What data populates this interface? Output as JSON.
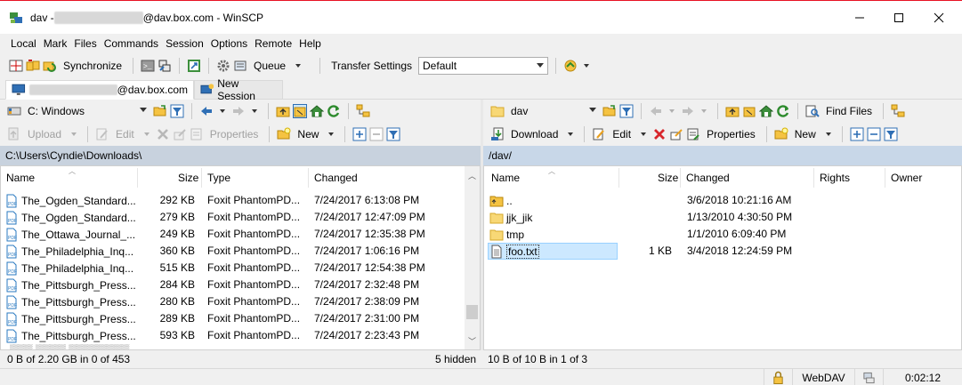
{
  "window": {
    "title_prefix": "dav - ",
    "title_suffix": "@dav.box.com - WinSCP"
  },
  "menu": [
    "Local",
    "Mark",
    "Files",
    "Commands",
    "Session",
    "Options",
    "Remote",
    "Help"
  ],
  "toolbar": {
    "synchronize": "Synchronize",
    "queue": "Queue",
    "transfer_settings_label": "Transfer Settings",
    "transfer_settings_value": "Default"
  },
  "tabs": {
    "session_suffix": "@dav.box.com",
    "new_session": "New Session"
  },
  "left": {
    "drive": "C: Windows",
    "upload": "Upload",
    "edit": "Edit",
    "properties": "Properties",
    "new": "New",
    "path": "C:\\Users\\Cyndie\\Downloads\\",
    "columns": {
      "name": "Name",
      "size": "Size",
      "type": "Type",
      "changed": "Changed"
    },
    "files": [
      {
        "name": "The_Ogden_Standard...",
        "size": "292 KB",
        "type": "Foxit PhantomPD...",
        "changed": "7/24/2017  6:13:08 PM"
      },
      {
        "name": "The_Ogden_Standard...",
        "size": "279 KB",
        "type": "Foxit PhantomPD...",
        "changed": "7/24/2017  12:47:09 PM"
      },
      {
        "name": "The_Ottawa_Journal_...",
        "size": "249 KB",
        "type": "Foxit PhantomPD...",
        "changed": "7/24/2017  12:35:38 PM"
      },
      {
        "name": "The_Philadelphia_Inq...",
        "size": "360 KB",
        "type": "Foxit PhantomPD...",
        "changed": "7/24/2017  1:06:16 PM"
      },
      {
        "name": "The_Philadelphia_Inq...",
        "size": "515 KB",
        "type": "Foxit PhantomPD...",
        "changed": "7/24/2017  12:54:38 PM"
      },
      {
        "name": "The_Pittsburgh_Press...",
        "size": "284 KB",
        "type": "Foxit PhantomPD...",
        "changed": "7/24/2017  2:32:48 PM"
      },
      {
        "name": "The_Pittsburgh_Press...",
        "size": "280 KB",
        "type": "Foxit PhantomPD...",
        "changed": "7/24/2017  2:38:09 PM"
      },
      {
        "name": "The_Pittsburgh_Press...",
        "size": "289 KB",
        "type": "Foxit PhantomPD...",
        "changed": "7/24/2017  2:31:00 PM"
      },
      {
        "name": "The_Pittsburgh_Press...",
        "size": "593 KB",
        "type": "Foxit PhantomPD...",
        "changed": "7/24/2017  2:23:43 PM"
      }
    ],
    "status": "0 B of 2.20 GB in 0 of 453",
    "hidden": "5 hidden"
  },
  "right": {
    "folder": "dav",
    "find_files": "Find Files",
    "download": "Download",
    "edit": "Edit",
    "properties": "Properties",
    "new": "New",
    "path": "/dav/",
    "columns": {
      "name": "Name",
      "size": "Size",
      "changed": "Changed",
      "rights": "Rights",
      "owner": "Owner"
    },
    "files": [
      {
        "name": "..",
        "size": "",
        "changed": "3/6/2018  10:21:16 AM",
        "kind": "up"
      },
      {
        "name": "jjk_jik",
        "size": "",
        "changed": "1/13/2010  4:30:50 PM",
        "kind": "folder"
      },
      {
        "name": "tmp",
        "size": "",
        "changed": "1/1/2010  6:09:40 PM",
        "kind": "folder"
      },
      {
        "name": "foo.txt",
        "size": "1 KB",
        "changed": "3/4/2018  12:24:59 PM",
        "kind": "file"
      }
    ],
    "status": "10 B of 10 B in 1 of 3"
  },
  "statusbar": {
    "protocol": "WebDAV",
    "elapsed": "0:02:12"
  },
  "colors": {
    "path_left": "#c8d2de",
    "path_right": "#c8d7e8",
    "selection": "#cce8ff",
    "folder": "#f5c342",
    "pdf_blue": "#2a7ac0"
  }
}
